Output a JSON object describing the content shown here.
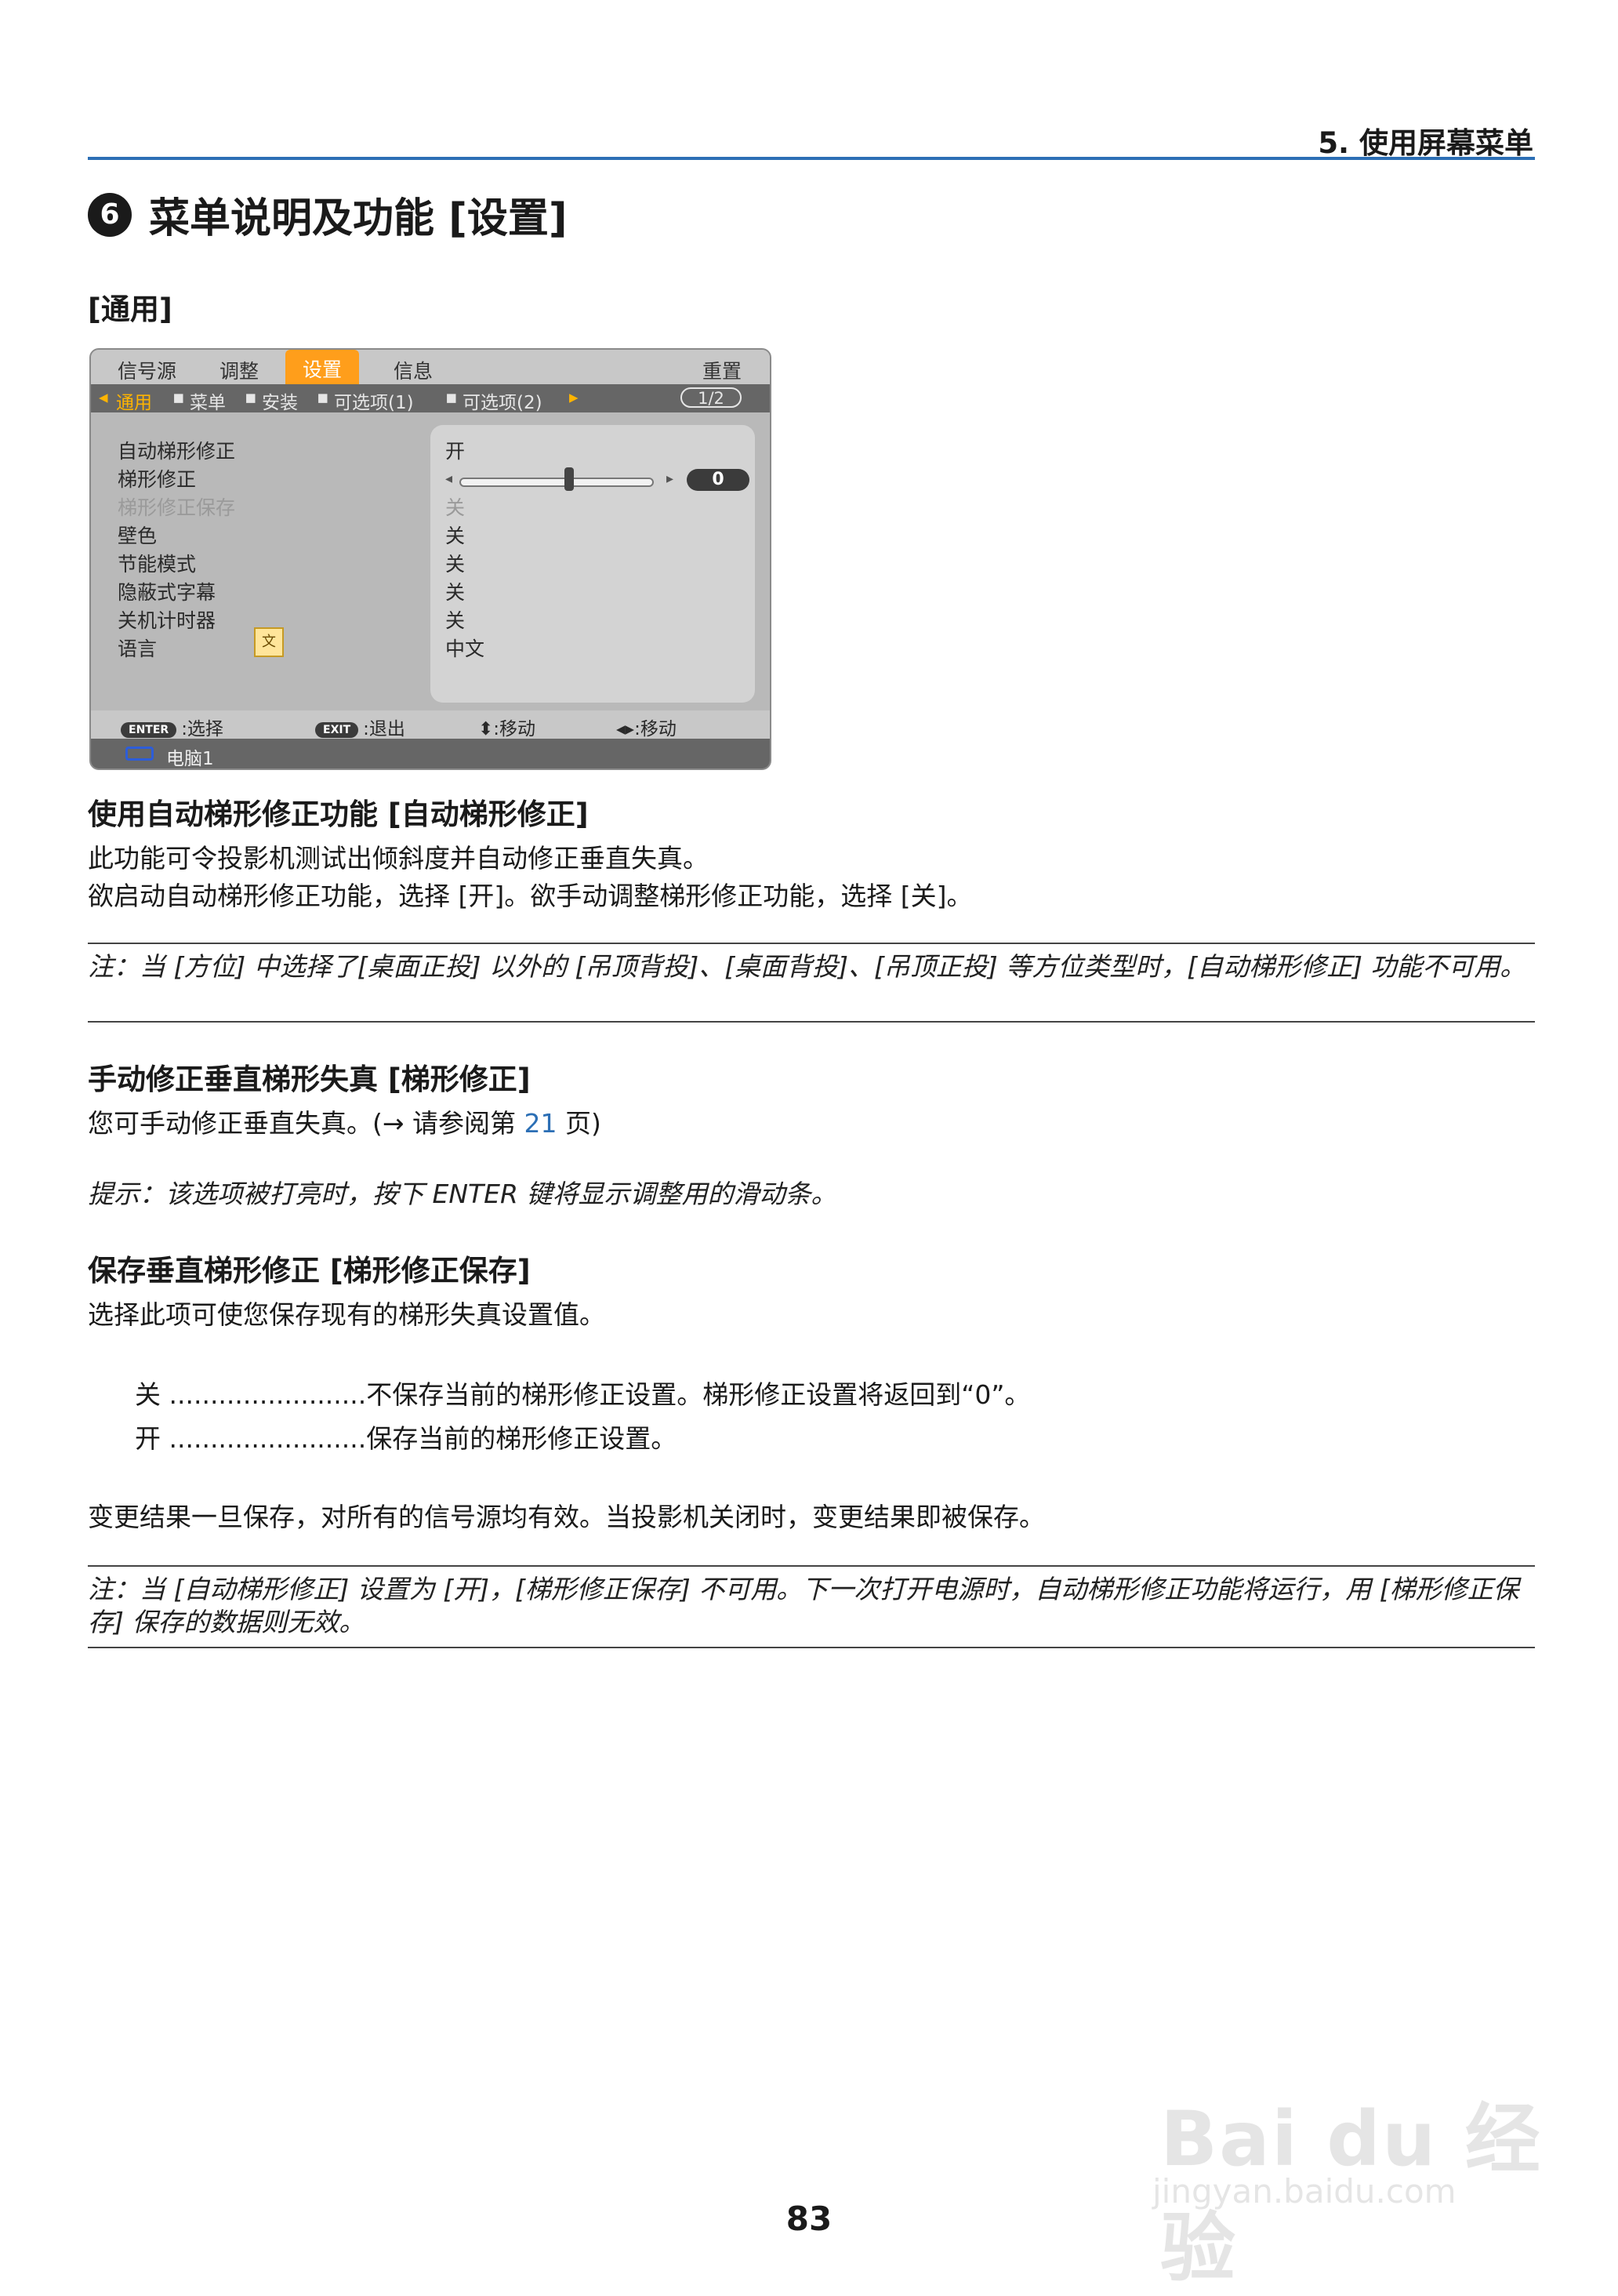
{
  "header": {
    "chapter": "5. 使用屏幕菜单"
  },
  "title": {
    "number": "6",
    "text": "菜单说明及功能 [设置]"
  },
  "subtitle": "[通用]",
  "osd": {
    "tabs": [
      "信号源",
      "调整",
      "设置",
      "信息"
    ],
    "active_tab": "设置",
    "reset": "重置",
    "subtabs": [
      "通用",
      "菜单",
      "安装",
      "可选项(1)",
      "可选项(2)"
    ],
    "page": "1/2",
    "rows": [
      {
        "label": "自动梯形修正",
        "value": "开",
        "dim": false
      },
      {
        "label": "梯形修正",
        "value": "0",
        "dim": false
      },
      {
        "label": "梯形修正保存",
        "value": "关",
        "dim": true
      },
      {
        "label": "壁色",
        "value": "关",
        "dim": false
      },
      {
        "label": "节能模式",
        "value": "关",
        "dim": false
      },
      {
        "label": "隐蔽式字幕",
        "value": "关",
        "dim": false
      },
      {
        "label": "关机计时器",
        "value": "关",
        "dim": false
      },
      {
        "label": "语言",
        "value": "中文",
        "dim": false
      }
    ],
    "keystone_slider_level": 0,
    "footer": {
      "enter_key": "ENTER",
      "enter_text": ":选择",
      "exit_key": "EXIT",
      "exit_text": ":退出",
      "updown_text": "⬍:移动",
      "leftright_text": "◂▸:移动"
    },
    "source": "电脑1"
  },
  "sections": {
    "auto_keystone": {
      "heading": "使用自动梯形修正功能 [自动梯形修正]",
      "line1": "此功能可令投影机测试出倾斜度并自动修正垂直失真。",
      "line2": "欲启动自动梯形修正功能，选择 [开]。欲手动调整梯形修正功能，选择 [关]。",
      "note": "注：当 [方位] 中选择了[桌面正投] 以外的 [吊顶背投]、[桌面背投]、[吊顶正投] 等方位类型时，[自动梯形修正] 功能不可用。"
    },
    "keystone": {
      "heading": "手动修正垂直梯形失真 [梯形修正]",
      "line_prefix": "您可手动修正垂直失真。(→ 请参阅第 ",
      "line_link": "21",
      "line_suffix": " 页)",
      "tip": "提示：该选项被打亮时，按下 ENTER 键将显示调整用的滑动条。"
    },
    "keystone_save": {
      "heading": "保存垂直梯形修正 [梯形修正保存]",
      "line1": "选择此项可使您保存现有的梯形失真设置值。",
      "def_off": "关 ........................不保存当前的梯形修正设置。梯形修正设置将返回到“0”。",
      "def_on": "开 ........................保存当前的梯形修正设置。",
      "line2": "变更结果一旦保存，对所有的信号源均有效。当投影机关闭时，变更结果即被保存。",
      "note": "注：当 [自动梯形修正] 设置为 [开]，[梯形修正保存] 不可用。下一次打开电源时，自动梯形修正功能将运行，用 [梯形修正保存] 保存的数据则无效。"
    }
  },
  "page_number": "83",
  "watermark": {
    "brand": "Bai du 经验",
    "url": "jingyan.baidu.com"
  }
}
